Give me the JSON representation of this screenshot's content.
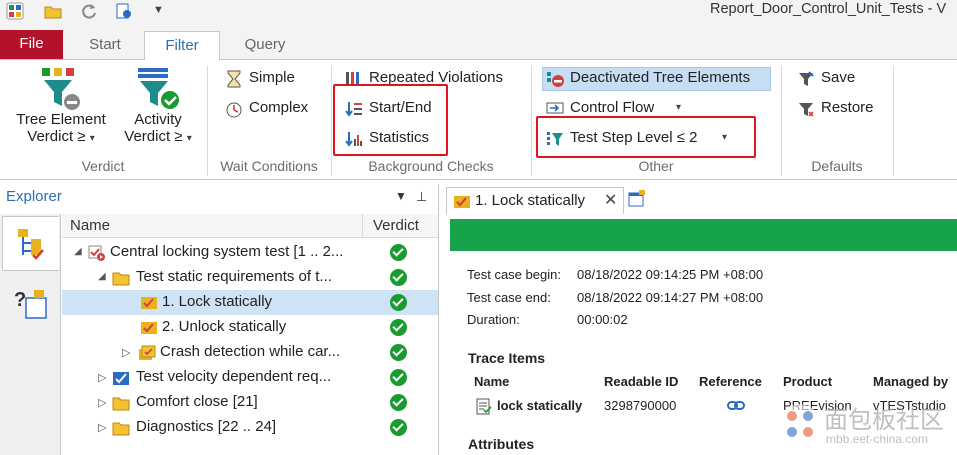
{
  "window": {
    "title": "Report_Door_Control_Unit_Tests - V"
  },
  "tabs": [
    {
      "label": "File"
    },
    {
      "label": "Start"
    },
    {
      "label": "Filter"
    },
    {
      "label": "Query"
    }
  ],
  "ribbon": {
    "verdict_group": {
      "tree_element_line1": "Tree Element",
      "tree_element_line2": "Verdict ≥",
      "activity_line1": "Activity",
      "activity_line2": "Verdict ≥",
      "label": "Verdict"
    },
    "wait_group": {
      "simple": "Simple",
      "complex": "Complex",
      "label": "Wait Conditions"
    },
    "background_group": {
      "repeated_violations": "Repeated Violations",
      "start_end": "Start/End",
      "statistics": "Statistics",
      "label": "Background Checks"
    },
    "other_group": {
      "deactivated": "Deactivated Tree Elements",
      "control_flow": "Control Flow",
      "test_step_level": "Test Step Level ≤ 2",
      "label": "Other"
    },
    "defaults_group": {
      "save": "Save",
      "restore": "Restore",
      "label": "Defaults"
    }
  },
  "explorer": {
    "title": "Explorer",
    "columns": {
      "name": "Name",
      "verdict": "Verdict"
    },
    "rows": [
      {
        "label": "Central locking system test [1 .. 2..."
      },
      {
        "label": "Test static requirements of t..."
      },
      {
        "label": "1. Lock statically"
      },
      {
        "label": "2. Unlock statically"
      },
      {
        "label": "Crash detection while car..."
      },
      {
        "label": "Test velocity dependent req..."
      },
      {
        "label": "Comfort close [21]"
      },
      {
        "label": "Diagnostics [22 .. 24]"
      }
    ]
  },
  "detail": {
    "tab_label": "1. Lock statically",
    "begin_label": "Test case begin:",
    "begin_value": "08/18/2022 09:14:25 PM +08:00",
    "end_label": "Test case end:",
    "end_value": "08/18/2022 09:14:27 PM +08:00",
    "duration_label": "Duration:",
    "duration_value": "00:00:02",
    "trace_title": "Trace Items",
    "trace_columns": {
      "name": "Name",
      "readable_id": "Readable ID",
      "reference": "Reference",
      "product": "Product",
      "managed_by": "Managed by"
    },
    "trace_row": {
      "name": "lock statically",
      "readable_id": "3298790000",
      "product": "PREEvision",
      "managed_by": "vTESTstudio"
    },
    "attributes_title": "Attributes"
  },
  "watermark": {
    "text": "面包板社区",
    "url": "mbb.eet-china.com"
  },
  "colors": {
    "file_tab": "#b3132a",
    "accent": "#2d6fb3",
    "pass": "#17a34a",
    "highlight": "#e0141e"
  }
}
